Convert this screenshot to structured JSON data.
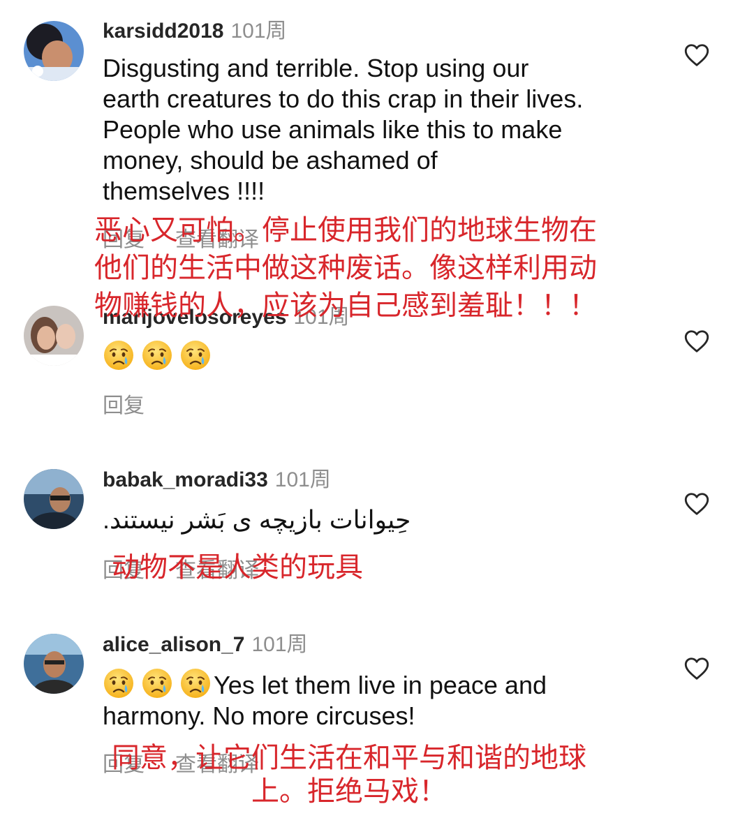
{
  "comments": [
    {
      "username": "karsidd2018",
      "time": "101周",
      "text_lines": [
        "Disgusting and terrible. Stop using our",
        "earth creatures to do this crap in their lives.",
        "People who use animals like this to make",
        "money, should be ashamed of",
        "themselves !!!!"
      ],
      "reply": "回复",
      "translate": "查看翻译",
      "overlay_lines": [
        "恶心又可怕。停止使用我们的地球生物在",
        "他们的生活中做这种废话。像这样利用动",
        "物赚钱的人，应该为自己感到羞耻！！！"
      ]
    },
    {
      "username": "marijovelosoreyes",
      "time": "101周",
      "emojis": [
        "crying-face",
        "crying-face",
        "crying-face"
      ],
      "reply": "回复"
    },
    {
      "username": "babak_moradi33",
      "time": "101周",
      "text": "حِیوانات بازیچه ی بَشر نیستند.",
      "reply": "回复",
      "translate": "查看翻译",
      "overlay_lines": [
        "动物不是人类的玩具"
      ]
    },
    {
      "username": "alice_alison_7",
      "time": "101周",
      "emojis": [
        "crying-face",
        "crying-face",
        "crying-face"
      ],
      "text_lines": [
        "Yes let them live in peace and",
        "harmony. No more circuses!"
      ],
      "reply": "回复",
      "translate": "查看翻译",
      "overlay_lines": [
        "同意，让它们生活在和平与和谐的地球",
        "上。拒绝马戏！"
      ]
    }
  ],
  "colors": {
    "overlay_text": "#d8262b",
    "muted": "#8e8e8e",
    "username": "#262626"
  }
}
